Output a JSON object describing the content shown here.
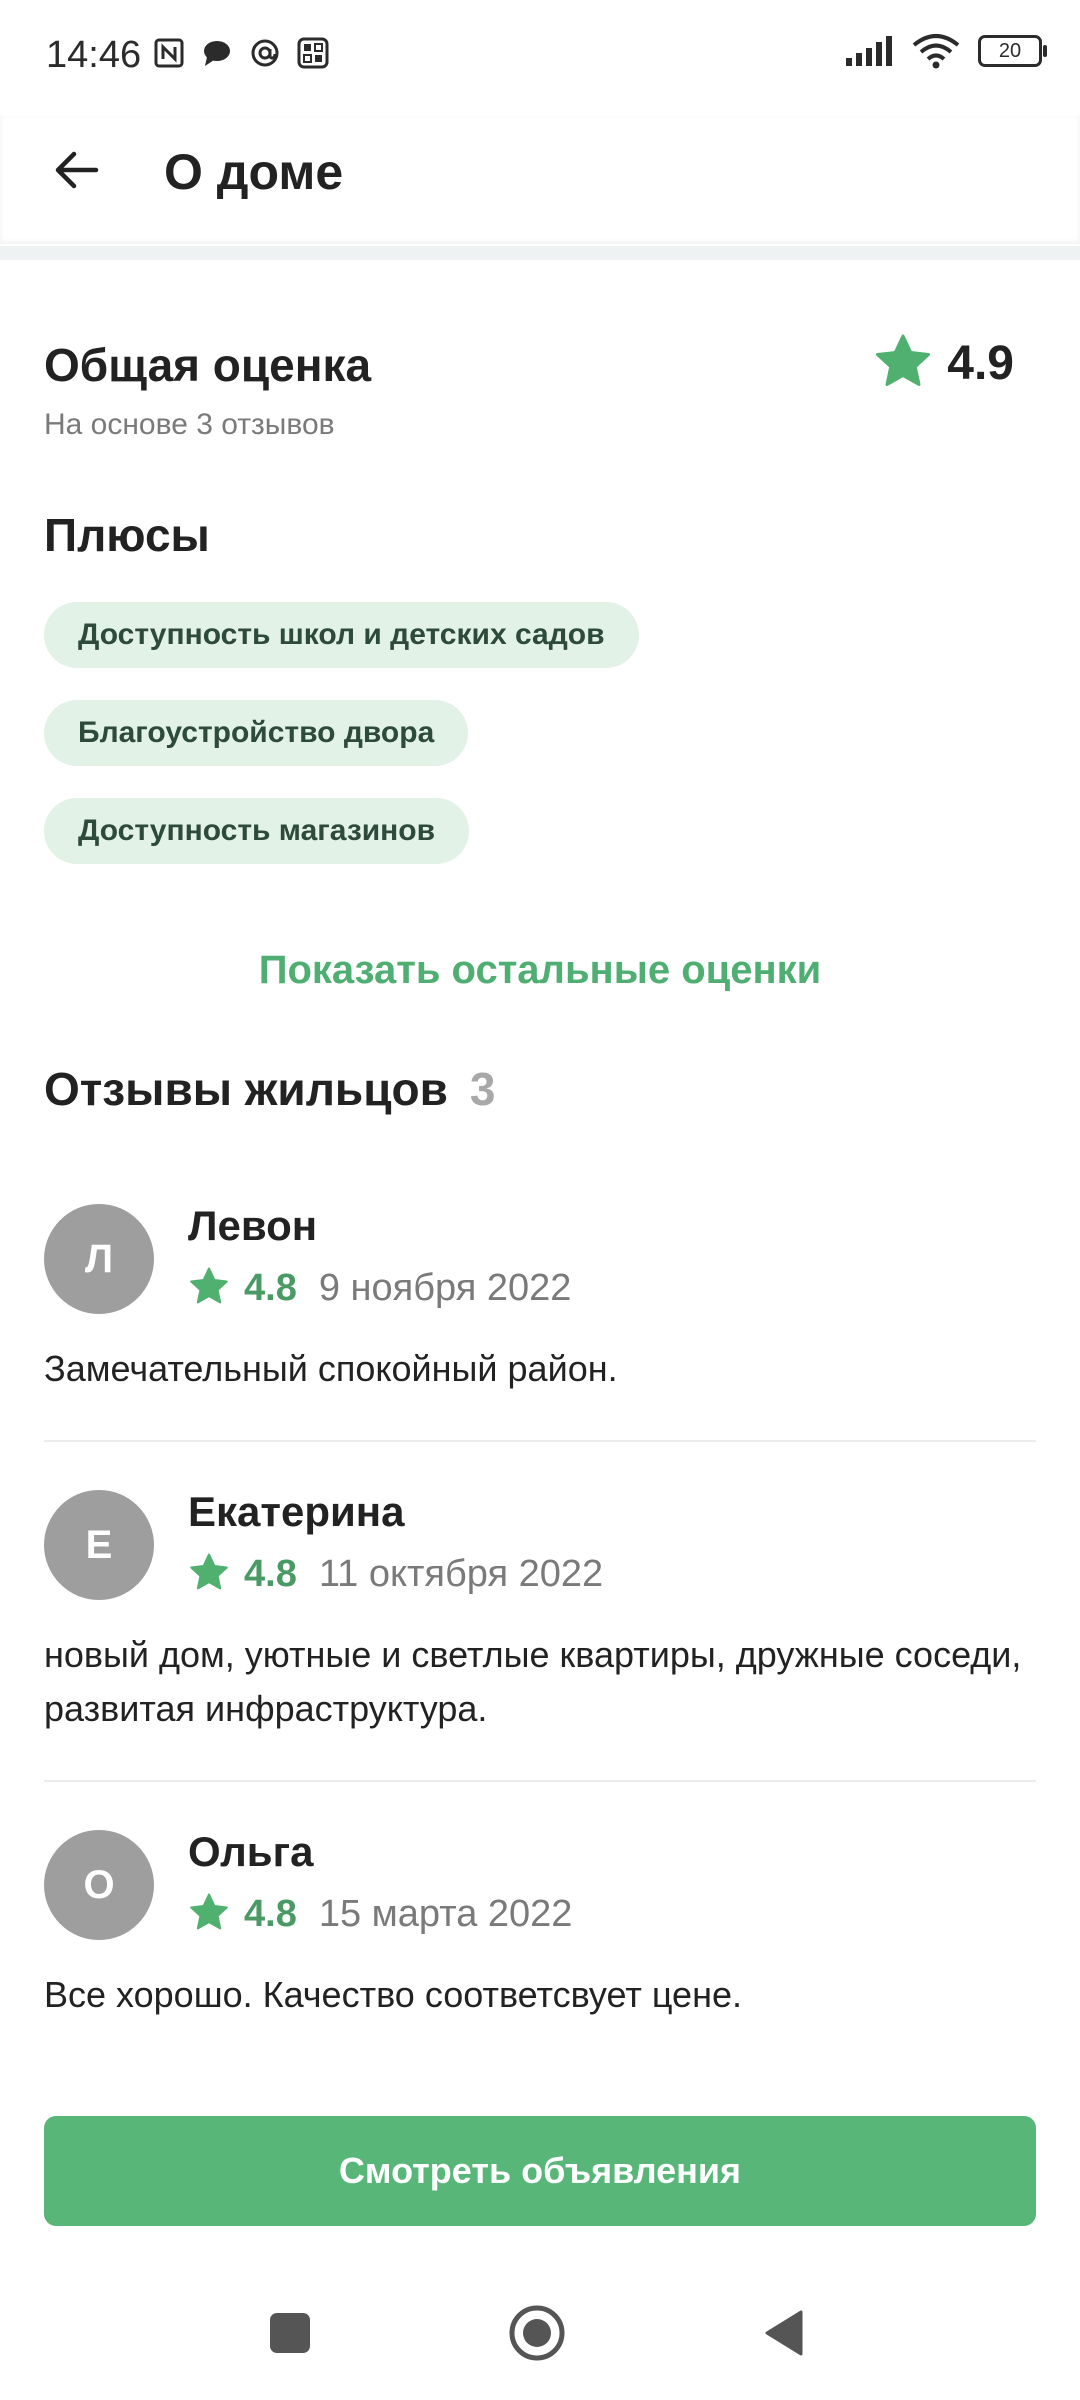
{
  "status_bar": {
    "time": "14:46",
    "battery": "20",
    "icons": [
      "nfc-icon",
      "chat-icon",
      "at-icon",
      "qr-icon",
      "signal-icon",
      "wifi-icon",
      "battery-icon"
    ]
  },
  "header": {
    "title": "О доме",
    "back_icon": "arrow-left-icon"
  },
  "overall": {
    "title": "Общая оценка",
    "subtitle": "На основе 3 отзывов",
    "score": "4.9",
    "star_color": "#4fb06f"
  },
  "pros": {
    "title": "Плюсы",
    "items": [
      {
        "label": "Доступность школ и детских садов"
      },
      {
        "label": "Благоустройство двора"
      },
      {
        "label": "Доступность магазинов"
      }
    ]
  },
  "show_more": "Показать остальные оценки",
  "reviews": {
    "title": "Отзывы жильцов",
    "count": "3",
    "items": [
      {
        "initial": "Л",
        "name": "Левон",
        "score": "4.8",
        "date": "9 ноября 2022",
        "text": "Замечательный спокойный район."
      },
      {
        "initial": "Е",
        "name": "Екатерина",
        "score": "4.8",
        "date": "11 октября 2022",
        "text": "новый дом, уютные и светлые квартиры, дружные соседи, развитая инфраструктура."
      },
      {
        "initial": "О",
        "name": "Ольга",
        "score": "4.8",
        "date": "15 марта 2022",
        "text": "Все хорошо. Качество соответсвует цене."
      }
    ]
  },
  "cta": {
    "label": "Смотреть объявления",
    "color": "#58b778"
  },
  "nav": {
    "icons": [
      "recent-apps-icon",
      "home-icon",
      "back-icon"
    ]
  }
}
